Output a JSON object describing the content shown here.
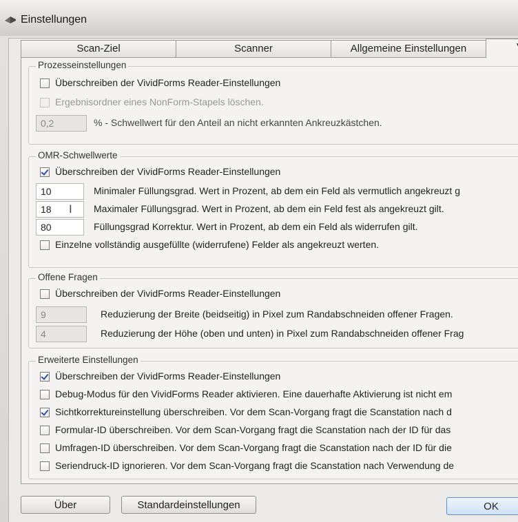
{
  "window": {
    "title": "Einstellungen"
  },
  "tabs": [
    "Scan-Ziel",
    "Scanner",
    "Allgemeine Einstellungen",
    "V"
  ],
  "prozess": {
    "legend": "Prozesseinstellungen",
    "override": {
      "label": "Überschreiben der VividForms Reader-Einstellungen",
      "checked": false
    },
    "nonform": {
      "label": "Ergebnisordner eines NonForm-Stapels löschen.",
      "checked": false
    },
    "threshold": {
      "value": "0,2",
      "text": "% - Schwellwert für den Anteil an nicht erkannten Ankreuzkästchen."
    }
  },
  "omr": {
    "legend": "OMR-Schwellwerte",
    "override": {
      "label": "Überschreiben der VividForms Reader-Einstellungen",
      "checked": true
    },
    "min": {
      "value": "10",
      "text": "Minimaler Füllungsgrad. Wert in Prozent, ab dem ein Feld als vermutlich angekreuzt g"
    },
    "max": {
      "value": "18",
      "text": "Maximaler Füllungsgrad. Wert in Prozent, ab dem ein Feld fest als angekreuzt gilt."
    },
    "korr": {
      "value": "80",
      "text": "Füllungsgrad Korrektur. Wert in Prozent, ab dem ein Feld als widerrufen gilt."
    },
    "einzeln": {
      "label": "Einzelne vollständig ausgefüllte (widerrufene) Felder als angekreuzt werten.",
      "checked": false
    }
  },
  "offen": {
    "legend": "Offene Fragen",
    "override": {
      "label": "Überschreiben der VividForms Reader-Einstellungen",
      "checked": false
    },
    "breite": {
      "value": "9",
      "text": "Reduzierung der Breite (beidseitig) in Pixel zum Randabschneiden offener Fragen."
    },
    "hoehe": {
      "value": "4",
      "text": "Reduzierung der Höhe (oben und unten) in Pixel zum Randabschneiden offener Frag"
    }
  },
  "erweitert": {
    "legend": "Erweiterte Einstellungen",
    "items": [
      {
        "label": "Überschreiben der VividForms Reader-Einstellungen",
        "checked": true
      },
      {
        "label": "Debug-Modus für den VividForms Reader aktivieren. Eine dauerhafte Aktivierung ist nicht em",
        "checked": false
      },
      {
        "label": "Sichtkorrektureinstellung überschreiben. Vor dem Scan-Vorgang fragt die Scanstation nach d",
        "checked": true
      },
      {
        "label": "Formular-ID überschreiben. Vor dem Scan-Vorgang fragt die Scanstation nach der ID für das",
        "checked": false
      },
      {
        "label": "Umfragen-ID überschreiben. Vor dem Scan-Vorgang fragt die Scanstation nach der ID für die",
        "checked": false
      },
      {
        "label": "Seriendruck-ID ignorieren. Vor dem Scan-Vorgang fragt die Scanstation nach Verwendung de",
        "checked": false
      }
    ]
  },
  "buttons": {
    "about": "Über",
    "defaults": "Standardeinstellungen",
    "ok": "OK"
  }
}
